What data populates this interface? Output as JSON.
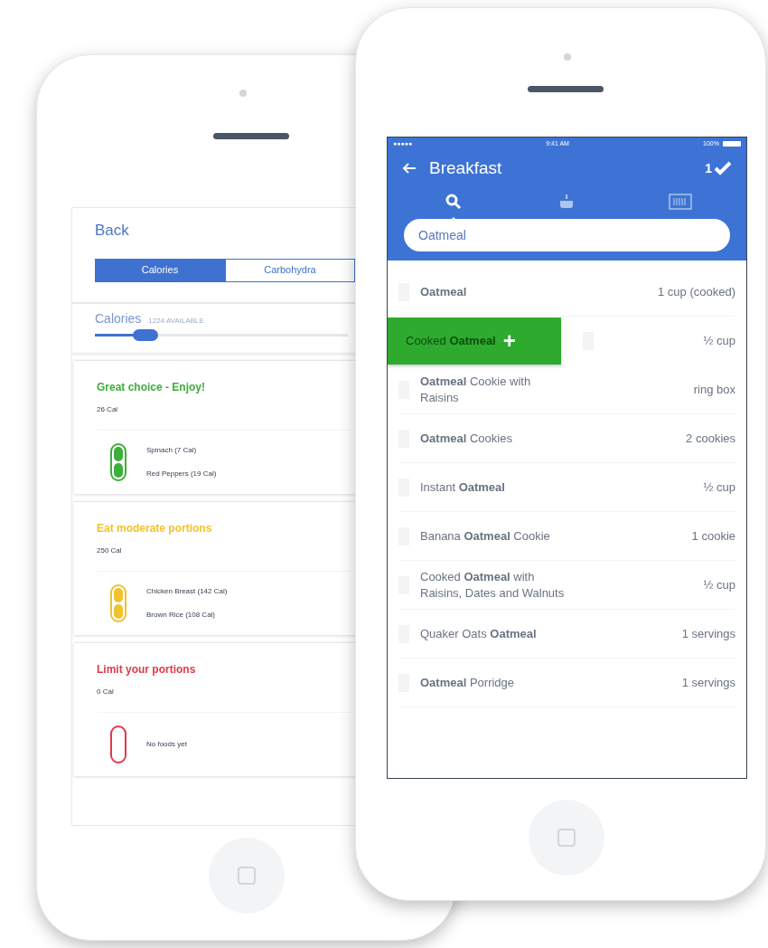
{
  "back_phone": {
    "back_link": "Back",
    "tabs": [
      {
        "label": "Calories",
        "selected": true
      },
      {
        "label": "Carbohydra",
        "selected": false
      }
    ],
    "calories": {
      "title": "Calories",
      "available": "1224 AVAILABLE",
      "level": 0.2
    },
    "groups": [
      {
        "title": "Great choice - Enjoy!",
        "color": "#3cae3c",
        "total": "26 Cal",
        "foods": [
          "Spinach (7 Cal)",
          "Red Peppers (19 Cal)"
        ]
      },
      {
        "title": "Eat moderate portions",
        "color": "#f2c12e",
        "total": "250 Cal",
        "foods": [
          "Chicken Breast (142 Cal)",
          "Brown Rice (108 Cal)"
        ]
      },
      {
        "title": "Limit your portions",
        "color": "#e0394b",
        "total": "0 Cal",
        "empty_text": "No foods yet"
      }
    ]
  },
  "front_phone": {
    "status_bar": {
      "carrier_dots": "●●●●●",
      "time": "9:41 AM",
      "battery": "100%"
    },
    "title": "Breakfast",
    "count": "1",
    "tabs": [
      {
        "kind": "search",
        "selected": true
      },
      {
        "kind": "meal",
        "selected": false
      },
      {
        "kind": "barcode",
        "selected": false
      }
    ],
    "search": {
      "value": "Oatmeal"
    },
    "results": [
      {
        "kind": "normal",
        "name": "**Oatmeal**",
        "serving": "1 cup (cooked)"
      },
      {
        "kind": "swiped",
        "name": "Cooked **Oatmeal**",
        "serving": "½ cup",
        "action": "+"
      },
      {
        "kind": "normal",
        "name": "**Oatmeal** Cookie with Raisins",
        "serving": "ring box"
      },
      {
        "kind": "normal",
        "name": "**Oatmeal** Cookies",
        "serving": "2 cookies"
      },
      {
        "kind": "normal",
        "name": "Instant **Oatmeal**",
        "serving": "½ cup"
      },
      {
        "kind": "normal",
        "name": "Banana **Oatmeal** Cookie",
        "serving": "1 cookie"
      },
      {
        "kind": "normal",
        "name": "Cooked **Oatmeal** with Raisins, Dates and Walnuts",
        "serving": "½ cup"
      },
      {
        "kind": "normal",
        "name": "Quaker Oats **Oatmeal**",
        "serving": "1 servings"
      },
      {
        "kind": "normal",
        "name": "**Oatmeal** Porridge",
        "serving": "1 servings"
      }
    ]
  }
}
